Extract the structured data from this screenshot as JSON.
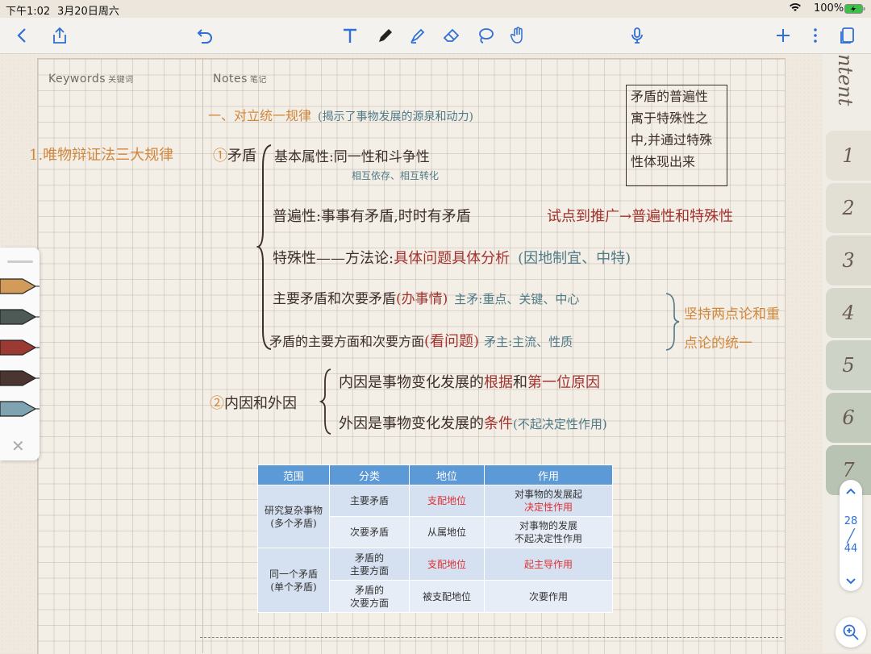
{
  "status": {
    "time": "下午1:02",
    "date": "3月20日周六",
    "battery": "100%"
  },
  "toolbar": {
    "icons": [
      "back-chevron-icon",
      "share-icon",
      "undo-icon",
      "text-tool-icon",
      "pen-icon",
      "highlighter-icon",
      "eraser-icon",
      "lasso-icon",
      "hand-gesture-icon",
      "microphone-icon",
      "add-icon",
      "more-icon",
      "pages-icon"
    ]
  },
  "page": {
    "keywords_label": "Keywords",
    "keywords_label_cn": "关键词",
    "notes_label": "Notes",
    "notes_label_cn": "笔记"
  },
  "keyword": "1.唯物辩证法三大规律",
  "notes": {
    "heading": "一、对立统一规律",
    "heading_note": "(揭示了事物发展的源泉和动力)",
    "topic1_num": "①",
    "topic1": "矛盾",
    "basic": "基本属性:同一性和斗争性",
    "basic_sub": "相互依存、相互转化",
    "universal": "普遍性:事事有矛盾,时时有矛盾",
    "universal_ext": "试点到推广→普遍性和特殊性",
    "special": "特殊性——方法论:",
    "special_method": "具体问题具体分析",
    "special_ext": "(因地制宜、中特)",
    "main": "主要矛盾和次要矛盾",
    "main_paren": "(办事情)",
    "main_ext": "主矛:重点、关键、中心",
    "aspect": "矛盾的主要方面和次要方面",
    "aspect_paren": "(看问题)",
    "aspect_ext": "矛主:主流、性质",
    "brace_note_1": "坚持两点论和重",
    "brace_note_2": "点论的统一",
    "topic2_num": "②",
    "topic2": "内因和外因",
    "internal_a": "内因是事物变化发展的",
    "internal_b": "根据",
    "internal_c": "和",
    "internal_d": "第一位原因",
    "external_a": "外因是事物变化发展的",
    "external_b": "条件",
    "external_c": "(不起决定性作用)"
  },
  "boxed_note": [
    "矛盾的普遍性",
    "寓于特殊性之",
    "中,并通过特殊",
    "性体现出来"
  ],
  "table": {
    "headers": [
      "范围",
      "分类",
      "地位",
      "作用"
    ],
    "group1": "研究复杂事物(多个矛盾)",
    "group1_a": "研究复杂事物",
    "group1_b": "(多个矛盾)",
    "group2_a": "同一个矛盾",
    "group2_b": "(单个矛盾)",
    "r1": {
      "cat": "主要矛盾",
      "pos": "支配地位",
      "role_a": "对事物的发展起",
      "role_b": "决定性作用"
    },
    "r2": {
      "cat": "次要矛盾",
      "pos": "从属地位",
      "role_a": "对事物的发展",
      "role_b": "不起决定性作用"
    },
    "r3": {
      "cat_a": "矛盾的",
      "cat_b": "主要方面",
      "pos": "支配地位",
      "role": "起主导作用"
    },
    "r4": {
      "cat_a": "矛盾的",
      "cat_b": "次要方面",
      "pos": "被支配地位",
      "role": "次要作用"
    }
  },
  "tabs": {
    "top_label": "ntent",
    "items": [
      "1",
      "2",
      "3",
      "4",
      "5",
      "6",
      "7"
    ]
  },
  "pager": {
    "current": "28",
    "total": "44"
  },
  "pens": {
    "colors": [
      "#d29b5a",
      "#4d5a55",
      "#9a3a33",
      "#4a3530",
      "#7fa3b0"
    ]
  }
}
